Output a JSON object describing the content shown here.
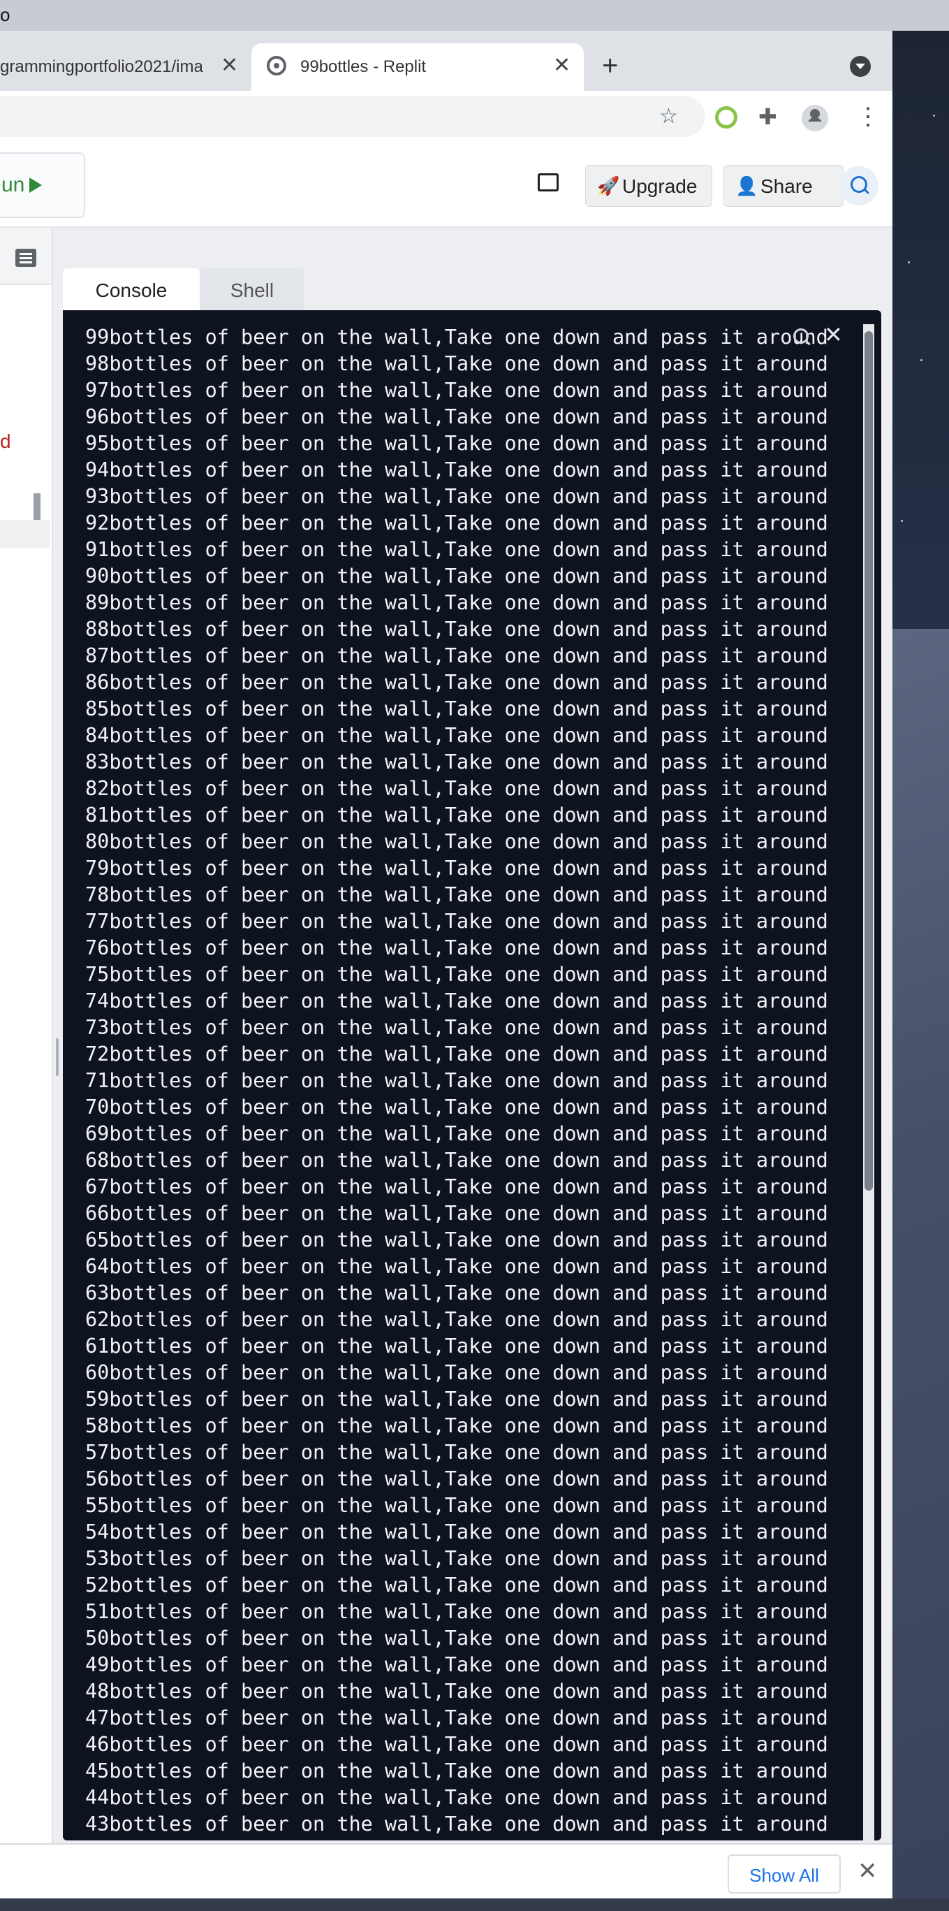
{
  "menubar": {
    "fragment": "o"
  },
  "browser": {
    "tabs": [
      {
        "label": "grammingportfolio2021/ima",
        "close": "✕"
      },
      {
        "label": "99bottles - Replit",
        "close": "✕"
      }
    ],
    "new_tab": "+",
    "download_bar": {
      "show_all": "Show All",
      "close": "✕"
    }
  },
  "replit": {
    "run_label": "un",
    "upgrade_label": "Upgrade",
    "share_label": "Share",
    "left_panel_fragment": "d",
    "tabs": {
      "console": "Console",
      "shell": "Shell"
    }
  },
  "console": {
    "close": "✕",
    "lines": [
      "99bottles of beer on the wall,Take one down and pass it around",
      "98bottles of beer on the wall,Take one down and pass it around",
      "97bottles of beer on the wall,Take one down and pass it around",
      "96bottles of beer on the wall,Take one down and pass it around",
      "95bottles of beer on the wall,Take one down and pass it around",
      "94bottles of beer on the wall,Take one down and pass it around",
      "93bottles of beer on the wall,Take one down and pass it around",
      "92bottles of beer on the wall,Take one down and pass it around",
      "91bottles of beer on the wall,Take one down and pass it around",
      "90bottles of beer on the wall,Take one down and pass it around",
      "89bottles of beer on the wall,Take one down and pass it around",
      "88bottles of beer on the wall,Take one down and pass it around",
      "87bottles of beer on the wall,Take one down and pass it around",
      "86bottles of beer on the wall,Take one down and pass it around",
      "85bottles of beer on the wall,Take one down and pass it around",
      "84bottles of beer on the wall,Take one down and pass it around",
      "83bottles of beer on the wall,Take one down and pass it around",
      "82bottles of beer on the wall,Take one down and pass it around",
      "81bottles of beer on the wall,Take one down and pass it around",
      "80bottles of beer on the wall,Take one down and pass it around",
      "79bottles of beer on the wall,Take one down and pass it around",
      "78bottles of beer on the wall,Take one down and pass it around",
      "77bottles of beer on the wall,Take one down and pass it around",
      "76bottles of beer on the wall,Take one down and pass it around",
      "75bottles of beer on the wall,Take one down and pass it around",
      "74bottles of beer on the wall,Take one down and pass it around",
      "73bottles of beer on the wall,Take one down and pass it around",
      "72bottles of beer on the wall,Take one down and pass it around",
      "71bottles of beer on the wall,Take one down and pass it around",
      "70bottles of beer on the wall,Take one down and pass it around",
      "69bottles of beer on the wall,Take one down and pass it around",
      "68bottles of beer on the wall,Take one down and pass it around",
      "67bottles of beer on the wall,Take one down and pass it around",
      "66bottles of beer on the wall,Take one down and pass it around",
      "65bottles of beer on the wall,Take one down and pass it around",
      "64bottles of beer on the wall,Take one down and pass it around",
      "63bottles of beer on the wall,Take one down and pass it around",
      "62bottles of beer on the wall,Take one down and pass it around",
      "61bottles of beer on the wall,Take one down and pass it around",
      "60bottles of beer on the wall,Take one down and pass it around",
      "59bottles of beer on the wall,Take one down and pass it around",
      "58bottles of beer on the wall,Take one down and pass it around",
      "57bottles of beer on the wall,Take one down and pass it around",
      "56bottles of beer on the wall,Take one down and pass it around",
      "55bottles of beer on the wall,Take one down and pass it around",
      "54bottles of beer on the wall,Take one down and pass it around",
      "53bottles of beer on the wall,Take one down and pass it around",
      "52bottles of beer on the wall,Take one down and pass it around",
      "51bottles of beer on the wall,Take one down and pass it around",
      "50bottles of beer on the wall,Take one down and pass it around",
      "49bottles of beer on the wall,Take one down and pass it around",
      "48bottles of beer on the wall,Take one down and pass it around",
      "47bottles of beer on the wall,Take one down and pass it around",
      "46bottles of beer on the wall,Take one down and pass it around",
      "45bottles of beer on the wall,Take one down and pass it around",
      "44bottles of beer on the wall,Take one down and pass it around",
      "43bottles of beer on the wall,Take one down and pass it around"
    ]
  },
  "icons": {
    "toolbar": [
      "star-icon",
      "extension-status-icon",
      "puzzle-icon",
      "profile-icon",
      "kebab-menu-icon"
    ],
    "console": [
      "search-icon",
      "close-icon"
    ]
  },
  "colors": {
    "console_bg": "#0e1320",
    "run_green": "#2f8a3a",
    "accent_blue": "#1a73e8"
  }
}
